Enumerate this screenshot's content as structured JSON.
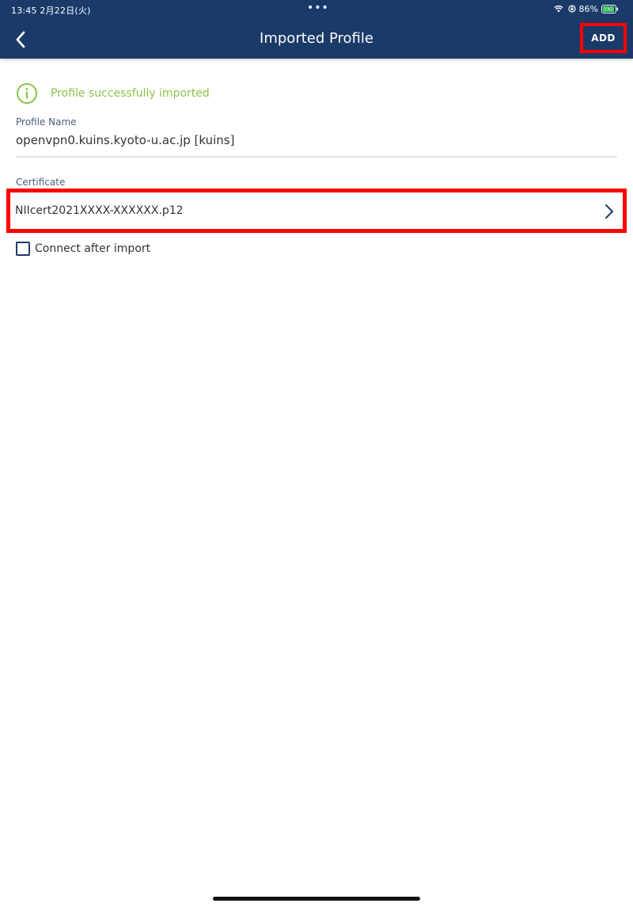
{
  "status_bar": {
    "time_date": "13:45  2月22日(火)",
    "dots": "•••",
    "battery": "86%"
  },
  "header": {
    "title": "Imported Profile",
    "add_label": "ADD",
    "back_icon": "chevron-left-icon"
  },
  "notice": {
    "icon": "info-icon",
    "text": "Profile successfully imported"
  },
  "profile": {
    "label": "Profile Name",
    "value": "openvpn0.kuins.kyoto-u.ac.jp [kuins]"
  },
  "certificate": {
    "label": "Certificate",
    "value": "NIIcert2021XXXX-XXXXXX.p12",
    "icon": "chevron-right-icon"
  },
  "connect_after_import": {
    "label": "Connect after import",
    "checked": false
  },
  "colors": {
    "header_bg": "#1a3a68",
    "success": "#8bc34a",
    "highlight": "#ff0000"
  }
}
